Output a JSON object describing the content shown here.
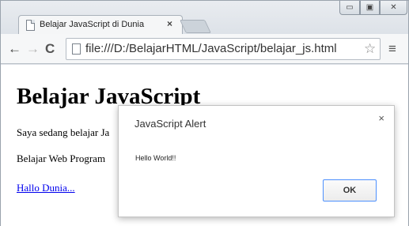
{
  "window": {
    "controls": {
      "minimize": "▭",
      "maximize": "▣",
      "close": "✕"
    }
  },
  "tab": {
    "title": "Belajar JavaScript di Dunia",
    "close": "×"
  },
  "toolbar": {
    "back": "←",
    "forward": "→",
    "reload": "C",
    "url": "file:///D:/BelajarHTML/JavaScript/belajar_js.html",
    "star": "☆",
    "menu": "≡"
  },
  "page": {
    "heading": "Belajar JavaScript",
    "paragraph1": "Saya sedang belajar Ja",
    "paragraph2": "Belajar Web Program",
    "link": "Hallo Dunia..."
  },
  "dialog": {
    "title": "JavaScript Alert",
    "close": "×",
    "message": "Hello World!!",
    "ok": "OK"
  }
}
